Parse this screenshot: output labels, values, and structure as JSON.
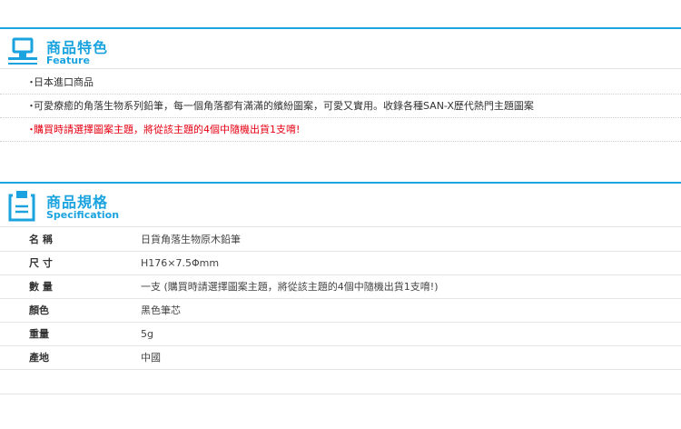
{
  "feature": {
    "title_zh": "商品特色",
    "title_en": "Feature",
    "bullet": "・",
    "items": [
      "日本進口商品",
      "可愛療癒的角落生物系列鉛筆，每一個角落都有滿滿的繽紛圖案，可愛又實用。收錄各種SAN-X歷代熱門主題圖案",
      "購買時請選擇圖案主題，將從該主題的4個中隨機出貨1支唷!"
    ]
  },
  "spec": {
    "title_zh": "商品規格",
    "title_en": "Specification",
    "rows": [
      {
        "label": "名 稱",
        "value": "日貨角落生物原木鉛筆"
      },
      {
        "label": "尺 寸",
        "value": "H176×7.5Φmm"
      },
      {
        "label": "數 量",
        "value": "一支 (購買時請選擇圖案主題，將從該主題的4個中隨機出貨1支唷!)"
      },
      {
        "label": "顏色",
        "value": "黑色筆芯"
      },
      {
        "label": "重量",
        "value": "5g"
      },
      {
        "label": "產地",
        "value": "中國"
      }
    ]
  },
  "colors": {
    "accent": "#1aa3de",
    "warning_text": "#e60012"
  }
}
